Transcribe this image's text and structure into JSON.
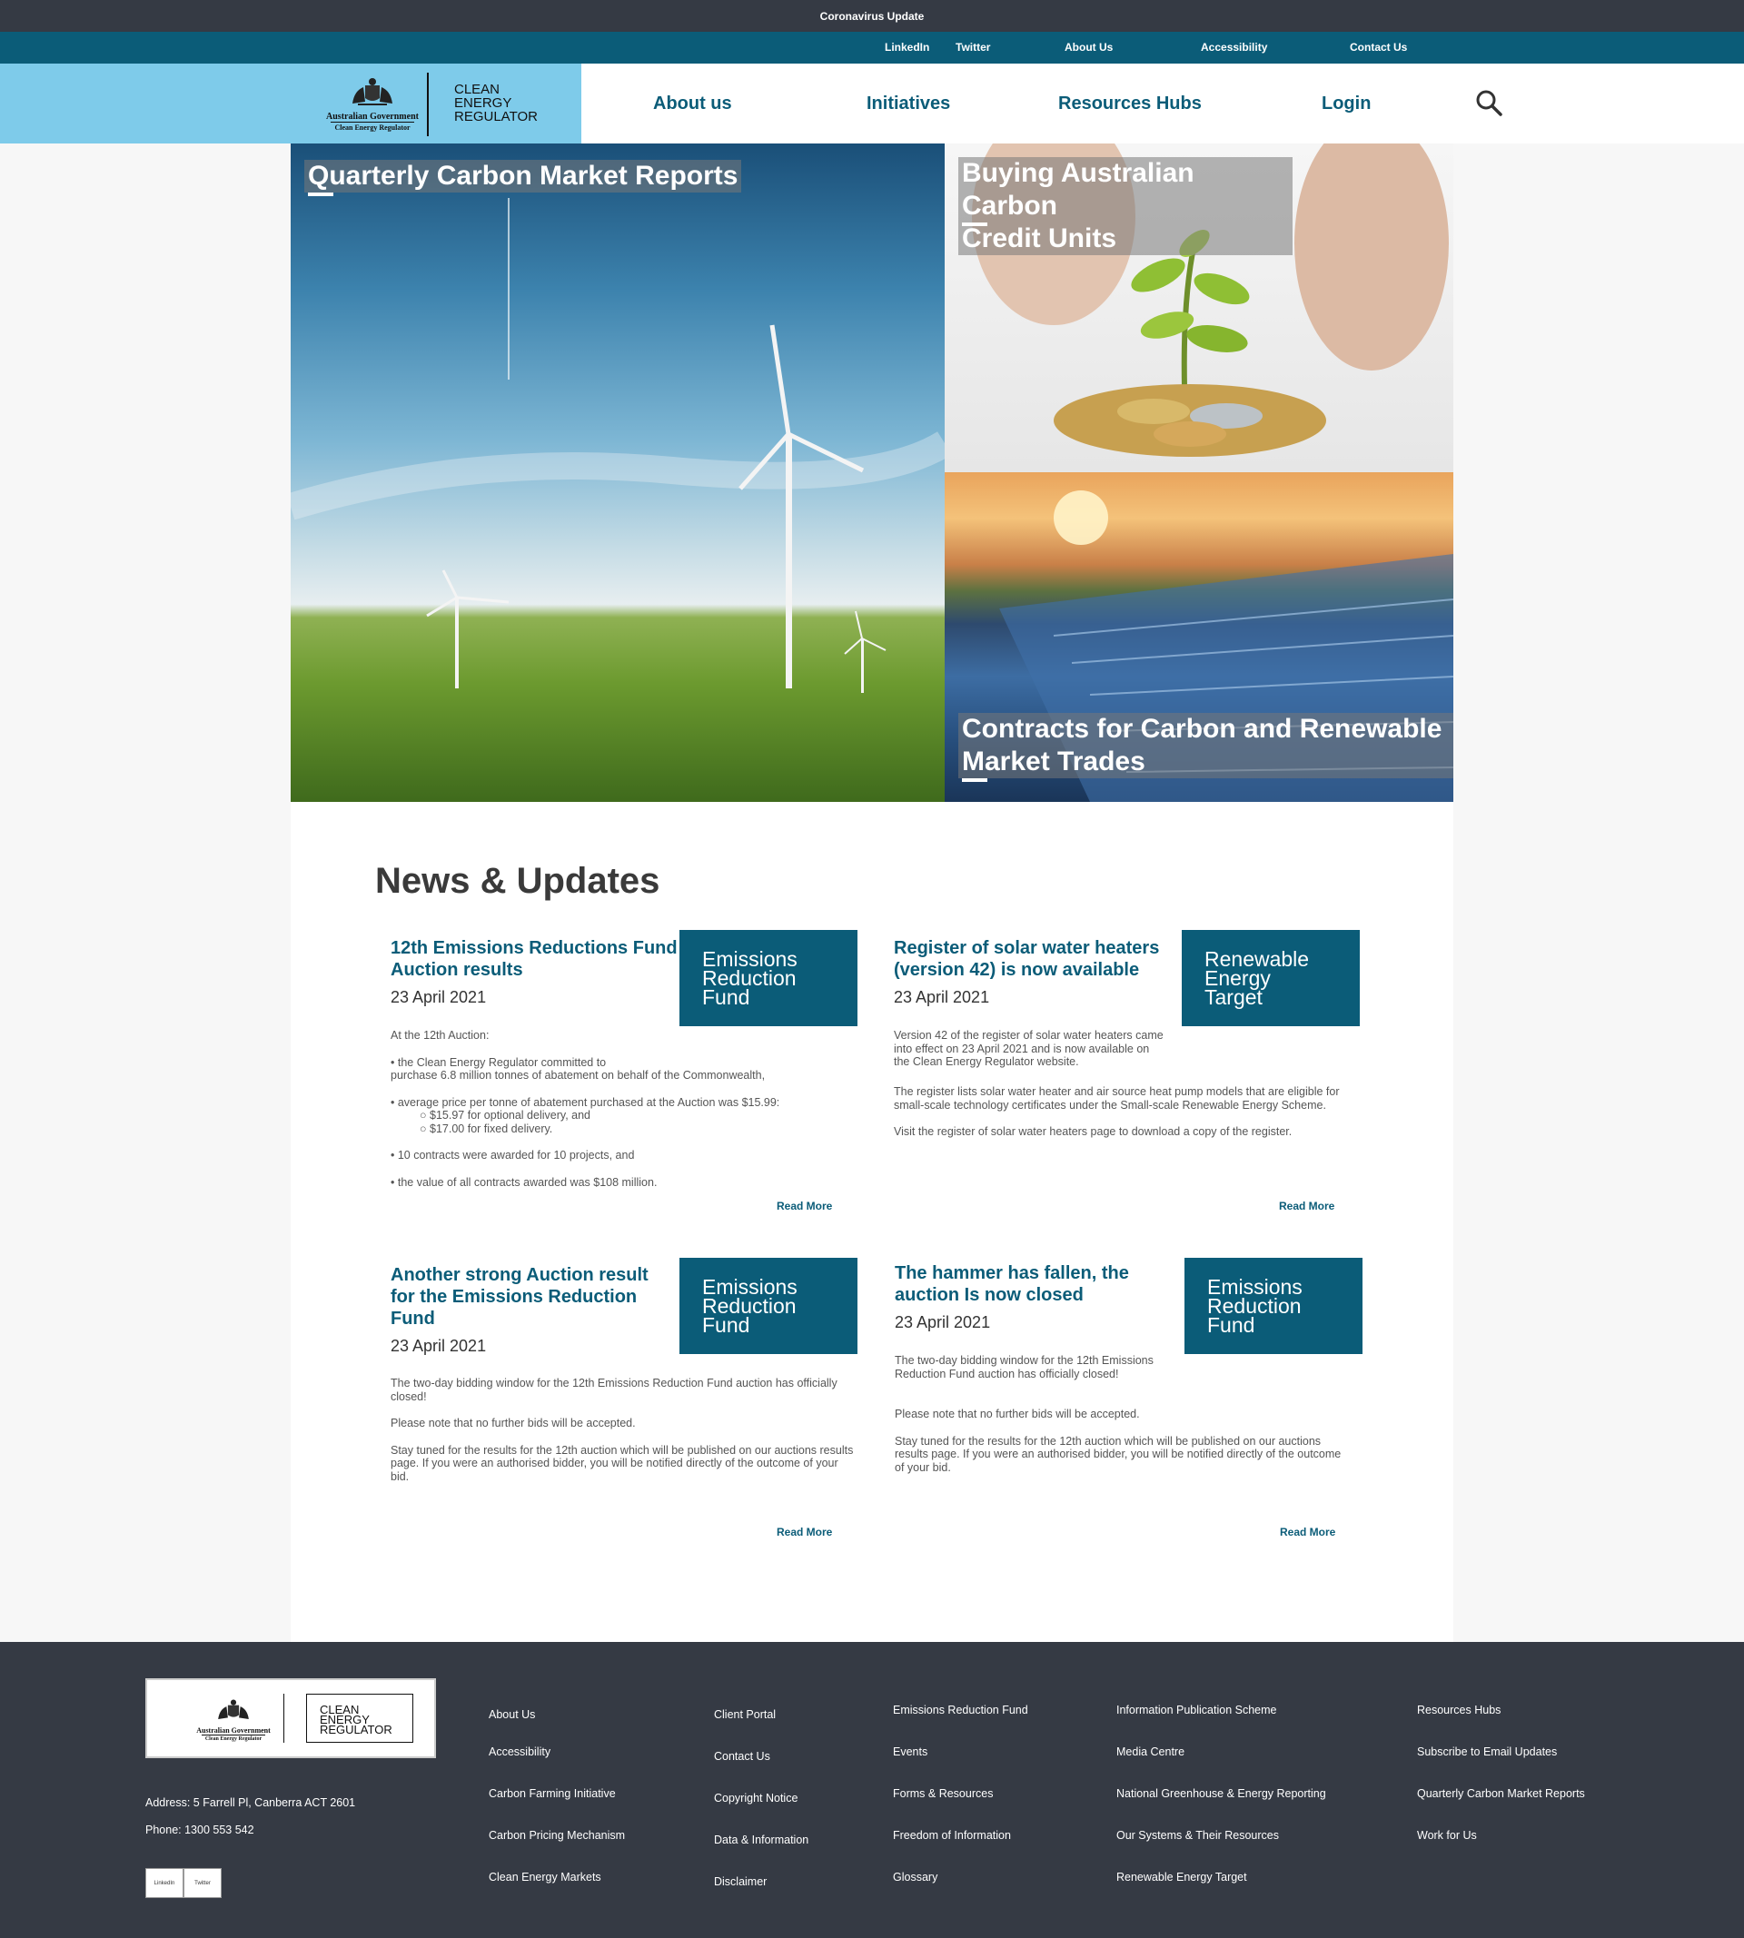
{
  "topbar": {
    "label": "Coronavirus Update"
  },
  "utility_links": [
    "LinkedIn",
    "Twitter",
    "About Us",
    "Accessibility",
    "Contact Us"
  ],
  "logo": {
    "gov_text": "Australian Government",
    "sub_text": "Clean Energy Regulator",
    "name_lines": [
      "CLEAN",
      "ENERGY",
      "REGULATOR"
    ]
  },
  "main_nav": [
    "About us",
    "Initiatives",
    "Resources Hubs",
    "Login"
  ],
  "hero": {
    "tile1": "Quarterly Carbon Market Reports",
    "tile2_lines": [
      "Buying Australian Carbon",
      "Credit Units"
    ],
    "tile3_lines": [
      "Contracts for Carbon and Renewable",
      "Market Trades"
    ]
  },
  "news": {
    "heading": "News & Updates",
    "read_more": "Read More",
    "items": [
      {
        "title": "12th Emissions Reductions Fund Auction results",
        "date": "23 April 2021",
        "tag_lines": [
          "Emissions",
          "Reduction",
          "Fund"
        ],
        "body": {
          "intro": "At the 12th Auction:",
          "b1a": "• the Clean Energy Regulator committed to",
          "b1b": "purchase 6.8 million tonnes of abatement on behalf of the Commonwealth,",
          "b2": "• average price per tonne of abatement purchased at the Auction was $15.99:",
          "s1": "○ $15.97 for optional delivery, and",
          "s2": "○ $17.00 for fixed delivery.",
          "b3": "• 10 contracts were awarded for 10 projects, and",
          "b4": "• the value of all contracts awarded was $108 million."
        }
      },
      {
        "title": "Register of solar water heaters (version 42) is now available",
        "date": "23 April 2021",
        "tag_lines": [
          "Renewable",
          "Energy",
          "Target"
        ],
        "paragraphs": [
          "Version 42 of the register of solar water heaters came into effect on 23 April 2021 and is now available on the Clean Energy Regulator website.",
          "The register lists solar water heater and air source heat pump models that are eligible for small-scale technology certificates under the Small-scale Renewable Energy Scheme.",
          "Visit the register of solar water heaters page to download a copy of the register."
        ]
      },
      {
        "title": "Another strong Auction result for the Emissions Reduction Fund",
        "date": "23 April 2021",
        "tag_lines": [
          "Emissions",
          "Reduction",
          "Fund"
        ],
        "paragraphs": [
          "The two-day bidding window for the 12th Emissions Reduction Fund auction has officially closed!",
          "Please note that no further bids will be accepted.",
          "Stay tuned for the results for the 12th auction which will be published on our auctions results page. If you were an authorised bidder, you will be notified directly of the outcome of your bid."
        ]
      },
      {
        "title": "The hammer has fallen, the auction Is now closed",
        "date": "23 April 2021",
        "tag_lines": [
          "Emissions",
          "Reduction",
          "Fund"
        ],
        "paragraphs": [
          "The two-day bidding window for the 12th Emissions Reduction Fund auction has officially closed!",
          "Please note that no further bids will be accepted.",
          "Stay tuned for the results for the 12th auction which will be published on our auctions results page. If you were an authorised bidder, you will be notified directly of the outcome of your bid."
        ]
      }
    ]
  },
  "footer": {
    "address": "Address: 5 Farrell Pl, Canberra ACT 2601",
    "phone": "Phone: 1300 553 542",
    "social": [
      "LinkedIn",
      "Twitter"
    ],
    "columns": [
      [
        "About Us",
        "Accessibility",
        "Carbon Farming Initiative",
        "Carbon Pricing Mechanism",
        "Clean Energy Markets"
      ],
      [
        "Client Portal",
        "Contact Us",
        "Copyright Notice",
        "Data & Information",
        "Disclaimer"
      ],
      [
        "Emissions Reduction Fund",
        "Events",
        "Forms & Resources",
        "Freedom of Information",
        "Glossary"
      ],
      [
        "Information Publication Scheme",
        "Media Centre",
        "National Greenhouse & Energy Reporting",
        "Our Systems & Their Resources",
        "Renewable Energy Target"
      ],
      [
        "Resources Hubs",
        "Subscribe to Email Updates",
        "Quarterly Carbon Market Reports",
        "Work for Us"
      ]
    ]
  },
  "icons": {
    "search": "search-icon",
    "crest": "coat-of-arms-icon"
  },
  "colors": {
    "topbar": "#353a44",
    "brand_teal": "#0b5c78",
    "logo_panel": "#7ecbea",
    "footer": "#353a44"
  }
}
